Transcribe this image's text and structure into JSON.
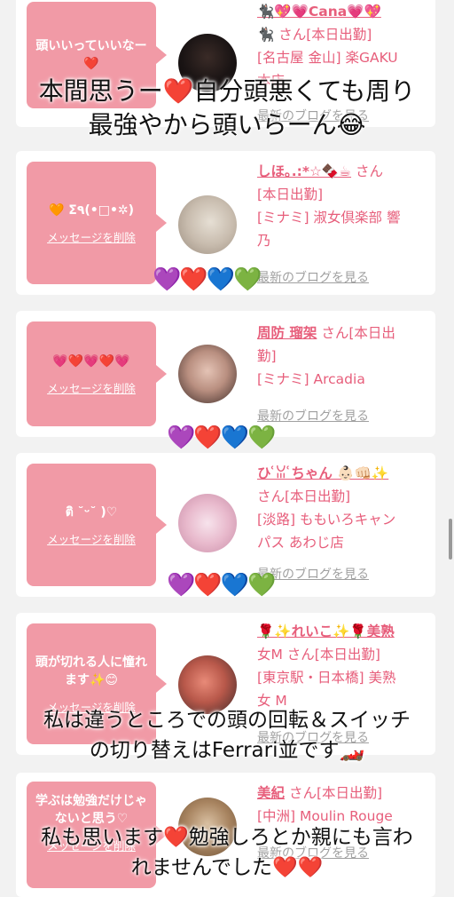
{
  "cards": [
    {
      "message": "頭いいっていいなー❤️",
      "name": "🐈‍⬛💖💗Cana💗💖",
      "info_lines": [
        "🐈‍⬛ さん[本日出勤]",
        "[名古屋 金山] 楽GAKU",
        "本店"
      ],
      "blog": "最新のブログを見る"
    },
    {
      "message": "🧡 Σ٩(•□•✲)",
      "delete": "メッセージを削除",
      "name": "しほ｡.:*☆🍫☕",
      "suffix": " さん",
      "info_lines": [
        "[本日出勤]",
        "[ミナミ] 淑女倶楽部 響",
        "乃"
      ],
      "blog": "最新のブログを見る"
    },
    {
      "message": "💗❤️💗❤️💗",
      "delete": "メッセージを削除",
      "name": "周防 瑠架",
      "suffix": " さん[本日出",
      "info_lines": [
        "勤]",
        "[ミナミ] Arcadia"
      ],
      "blog": "最新のブログを見る"
    },
    {
      "message": "ติ ˘ᵕ˘ )♡",
      "delete": "メッセージを削除",
      "name": "ひ ͑ꈍ ͑ちゃん 👶🏻👊🏻✨",
      "info_lines": [
        "さん[本日出勤]",
        "[淡路] ももいろキャン",
        "パス あわじ店"
      ],
      "blog": "最新のブログを見る"
    },
    {
      "message": "頭が切れる人に憧れます✨😊",
      "delete": "メッセージを削除",
      "name": "🌹✨れいこ✨🌹美熟",
      "info_lines": [
        "女M  さん[本日出勤]",
        "[東京駅・日本橋] 美熟",
        "女 M"
      ],
      "blog": "最新のブログを見る"
    },
    {
      "message": "学ぶは勉強だけじゃないと思う♡",
      "delete": "メッセージを削除",
      "name": "美紀",
      "suffix": " さん[本日出勤]",
      "info_lines": [
        "[中洲] Moulin Rouge"
      ],
      "blog": "最新のブログを見る"
    }
  ],
  "hearts": {
    "row1": "💜❤️💙💚",
    "row2": "💜❤️💙💚",
    "row3": "💜❤️💙💚"
  },
  "captions": {
    "c1_line1": "本間思うー❤️自分頭悪くても周り",
    "c1_line2": "最強やから頭いらーん😂",
    "c2_line1": "私は違うところでの頭の回転＆スイッチ",
    "c2_line2": "の切り替えはFerrari並です🏎️",
    "c3_line1": "私も思います❤️勉強しろとか親にも言わ",
    "c3_line2": "れませんでした❤️❤️"
  },
  "colors": {
    "bubble": "#f19aa6",
    "accent": "#e75e7b",
    "background": "#f2f2f2"
  }
}
